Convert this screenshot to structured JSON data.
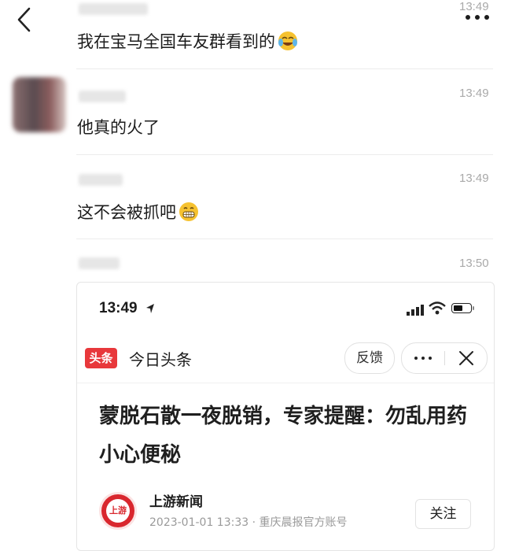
{
  "header": {
    "back_icon": "chevron-left-icon",
    "more_icon": "more-horizontal-icon"
  },
  "messages": [
    {
      "time": "13:49",
      "text": "我在宝马全国车友群看到的",
      "emoji": "rolling-laughing-emoji"
    },
    {
      "time": "13:49",
      "text": "他真的火了",
      "emoji": ""
    },
    {
      "time": "13:49",
      "text": "这不会被抓吧",
      "emoji": "grimacing-emoji"
    },
    {
      "time": "13:50"
    }
  ],
  "shared_card": {
    "status_time": "13:49",
    "app_logo_text": "头条",
    "app_name": "今日头条",
    "feedback_label": "反馈",
    "more_label": "···",
    "close_label": "✕",
    "headline": "蒙脱石散一夜脱销，专家提醒：勿乱用药小心便秘",
    "source": {
      "logo_text": "上游",
      "name": "上游新闻",
      "meta": "2023-01-01 13:33 · 重庆晨报官方账号"
    },
    "follow_label": "关注",
    "battery_level": 0.6
  },
  "colors": {
    "time_gray": "#a9a9a9",
    "toutiao_red": "#e8383b",
    "shangyou_red": "#d9272e"
  }
}
